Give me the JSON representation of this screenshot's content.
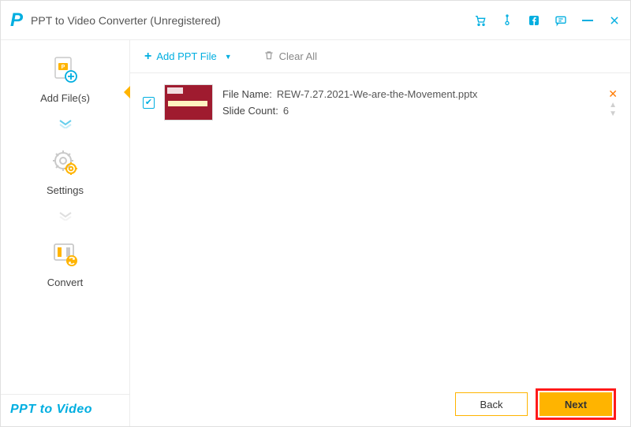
{
  "app": {
    "logo_letter": "P",
    "title": "PPT to Video Converter (Unregistered)",
    "brand_text": "PPT to Video"
  },
  "sidebar": {
    "add_files": "Add File(s)",
    "settings": "Settings",
    "convert": "Convert"
  },
  "toolbar": {
    "add_ppt": "Add PPT File",
    "clear_all": "Clear All"
  },
  "file": {
    "name_label": "File Name:",
    "name_value": "REW-7.27.2021-We-are-the-Movement.pptx",
    "count_label": "Slide Count:",
    "count_value": "6",
    "checked": true
  },
  "footer": {
    "back": "Back",
    "next": "Next"
  },
  "colors": {
    "accent": "#00aee0",
    "primary": "#ffb400",
    "highlight": "#ff1a1a"
  }
}
